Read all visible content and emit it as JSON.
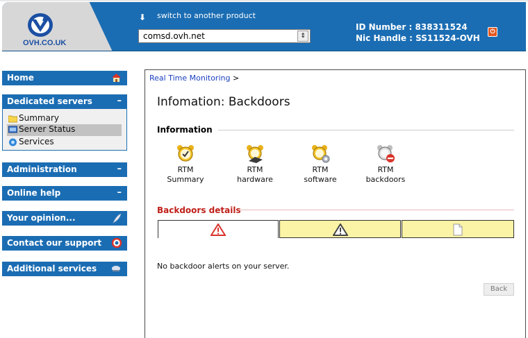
{
  "header": {
    "logo_text": "OVH.CO.UK",
    "switch_label": "switch to another product",
    "product_select_value": "comsd.ovh.net",
    "id_label": "ID Number :",
    "id_value": "838311524",
    "nic_label": "Nic Handle :",
    "nic_value": "SS11524-OVH"
  },
  "sidebar": {
    "home": "Home",
    "dedicated_servers": "Dedicated servers",
    "dedicated_toggle": "–",
    "items": [
      "Summary",
      "Server Status",
      "Services"
    ],
    "administration": "Administration",
    "administration_toggle": "–",
    "online_help": "Online help",
    "online_help_toggle": "–",
    "opinion": "Your opinion...",
    "contact": "Contact our support",
    "additional": "Additional services"
  },
  "main": {
    "breadcrumb_link": "Real Time Monitoring",
    "breadcrumb_sep": ">",
    "title": "Infomation: Backdoors",
    "information_heading": "Information",
    "rtm_items": [
      {
        "line1": "RTM",
        "line2": "Summary"
      },
      {
        "line1": "RTM",
        "line2": "hardware"
      },
      {
        "line1": "RTM",
        "line2": "software"
      },
      {
        "line1": "RTM",
        "line2": "backdoors"
      }
    ],
    "details_heading": "Backdoors details",
    "no_alerts": "No backdoor alerts on your server.",
    "back_button": "Back"
  },
  "colors": {
    "brand_blue": "#1b6db3",
    "details_red": "#c0201a",
    "tab_yellow": "#fbf3a5",
    "link_blue": "#1a3fbf"
  }
}
